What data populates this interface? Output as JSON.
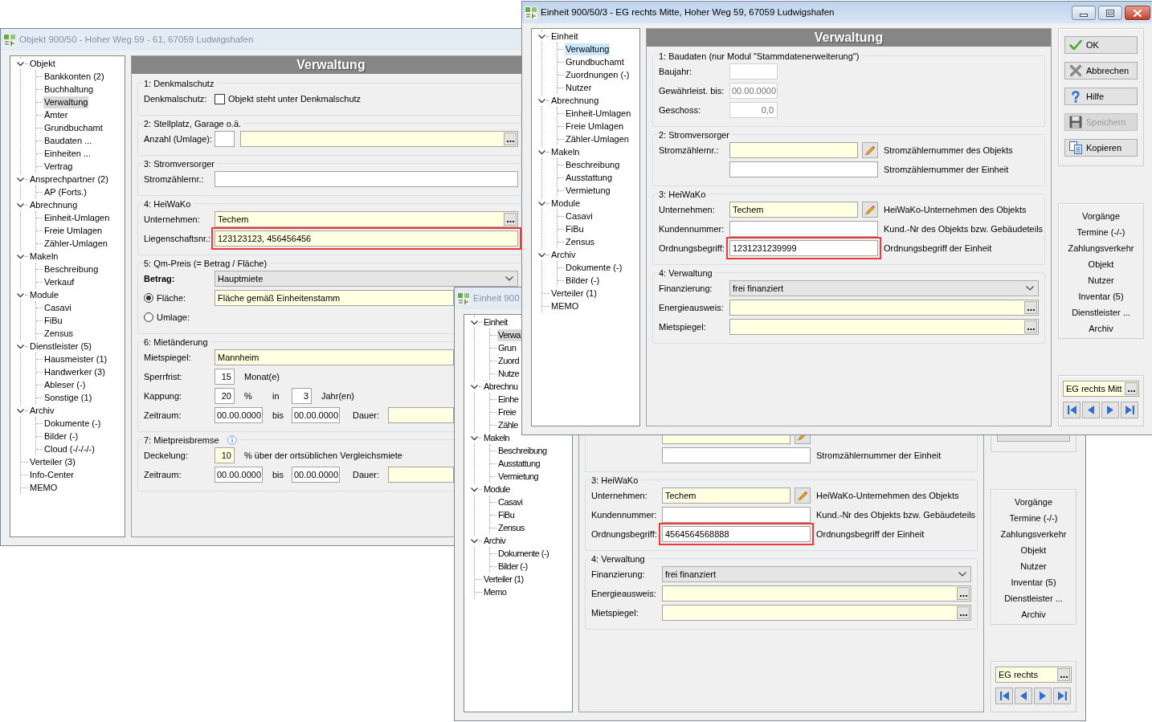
{
  "windows": [
    {
      "title": "Objekt 900/50 - Hoher Weg 59 - 61, 67059 Ludwigshafen",
      "active": false,
      "tree": [
        {
          "label": "Objekt",
          "selected": false,
          "expanded": true,
          "children": [
            {
              "label": "Bankkonten (2)",
              "selected": false
            },
            {
              "label": "Buchhaltung",
              "selected": false
            },
            {
              "label": "Verwaltung",
              "selected": true
            },
            {
              "label": "Ämter",
              "selected": false
            },
            {
              "label": "Grundbuchamt",
              "selected": false
            },
            {
              "label": "Baudaten ...",
              "selected": false
            },
            {
              "label": "Einheiten ...",
              "selected": false
            },
            {
              "label": "Vertrag",
              "selected": false
            }
          ]
        },
        {
          "label": "Ansprechpartner (2)",
          "selected": false,
          "expanded": true,
          "children": [
            {
              "label": "AP (Forts.)",
              "selected": false
            }
          ]
        },
        {
          "label": "Abrechnung",
          "selected": false,
          "expanded": true,
          "children": [
            {
              "label": "Einheit-Umlagen",
              "selected": false
            },
            {
              "label": "Freie Umlagen",
              "selected": false
            },
            {
              "label": "Zähler-Umlagen",
              "selected": false
            }
          ]
        },
        {
          "label": "Makeln",
          "selected": false,
          "expanded": true,
          "children": [
            {
              "label": "Beschreibung",
              "selected": false
            },
            {
              "label": "Verkauf",
              "selected": false
            }
          ]
        },
        {
          "label": "Module",
          "selected": false,
          "expanded": true,
          "children": [
            {
              "label": "Casavi",
              "selected": false
            },
            {
              "label": "FiBu",
              "selected": false
            },
            {
              "label": "Zensus",
              "selected": false
            }
          ]
        },
        {
          "label": "Dienstleister (5)",
          "selected": false,
          "expanded": true,
          "children": [
            {
              "label": "Hausmeister (1)",
              "selected": false
            },
            {
              "label": "Handwerker (3)",
              "selected": false
            },
            {
              "label": "Ableser (-)",
              "selected": false
            },
            {
              "label": "Sonstige (1)",
              "selected": false
            }
          ]
        },
        {
          "label": "Archiv",
          "selected": false,
          "expanded": true,
          "children": [
            {
              "label": "Dokumente (-)",
              "selected": false
            },
            {
              "label": "Bilder (-)",
              "selected": false
            },
            {
              "label": "Cloud (-/-/-/-)",
              "selected": false
            }
          ]
        },
        {
          "label": "Verteiler (3)",
          "selected": false
        },
        {
          "label": "Info-Center",
          "selected": false
        },
        {
          "label": "MEMO",
          "selected": false
        }
      ],
      "form": {
        "title": "Verwaltung",
        "groups": [
          {
            "title": "1: Denkmalschutz",
            "rows": [
              {
                "kind": "plain",
                "label": "Denkmalschutz:",
                "controls": [
                  {
                    "kind": "checkbox",
                    "text": "Objekt steht unter Denkmalschutz",
                    "checked": false
                  }
                ]
              }
            ]
          },
          {
            "title": "2: Stellplatz, Garage o.ä.",
            "rows": [
              {
                "kind": "plain",
                "label": "Anzahl (Umlage):",
                "controls": [
                  {
                    "kind": "number",
                    "readonly": false
                  },
                  {
                    "kind": "lookup",
                    "readonly": true
                  }
                ]
              }
            ]
          },
          {
            "title": "3: Stromversorger",
            "rows": [
              {
                "kind": "plain",
                "label": "Stromzählernr.:",
                "controls": [
                  {
                    "kind": "input",
                    "readonly": false
                  }
                ]
              }
            ]
          },
          {
            "title": "4: HeiWaKo",
            "rows": [
              {
                "kind": "plain",
                "label": "Unternehmen:",
                "controls": [
                  {
                    "kind": "lookup",
                    "readonly": true,
                    "value": "Techem",
                    "highlighted": false
                  }
                ]
              },
              {
                "kind": "plain",
                "label": "Liegenschaftsnr.:",
                "controls": [
                  {
                    "kind": "input",
                    "readonly": true,
                    "value": "123123123, 456456456",
                    "highlighted": true
                  }
                ]
              }
            ]
          },
          {
            "title": "5: Qm-Preis (= Betrag / Fläche)",
            "rows": [
              {
                "kind": "plain",
                "label": "Betrag:",
                "strong": true,
                "controls": [
                  {
                    "kind": "select",
                    "value": "Hauptmiete"
                  }
                ]
              },
              {
                "kind": "radio",
                "label": "Fläche:",
                "selected": true,
                "controls": [
                  {
                    "kind": "input",
                    "readonly": true,
                    "value": "Fläche gemäß Einheitenstamm"
                  }
                ]
              },
              {
                "kind": "radio",
                "label": "Umlage:",
                "selected": false
              }
            ]
          },
          {
            "title": "6: Mietänderung",
            "rows": [
              {
                "kind": "plain",
                "label": "Mietspiegel:",
                "controls": [
                  {
                    "kind": "input",
                    "readonly": true,
                    "value": "Mannheim"
                  }
                ]
              },
              {
                "kind": "plain",
                "label": "Sperrfrist:",
                "controls": [
                  {
                    "kind": "number",
                    "readonly": false,
                    "value": "15"
                  },
                  {
                    "kind": "unit",
                    "text": "Monat(e)"
                  }
                ]
              },
              {
                "kind": "plain",
                "label": "Kappung:",
                "controls": [
                  {
                    "kind": "number",
                    "readonly": false,
                    "value": "20"
                  },
                  {
                    "kind": "unit",
                    "text": "%"
                  },
                  {
                    "kind": "conjunction",
                    "text": "in"
                  },
                  {
                    "kind": "number",
                    "readonly": false,
                    "value": "3"
                  },
                  {
                    "kind": "unit",
                    "text": "Jahr(en)"
                  }
                ]
              },
              {
                "kind": "plain",
                "label": "Zeitraum:",
                "controls": [
                  {
                    "kind": "date",
                    "readonly": false,
                    "value": "00.00.0000"
                  },
                  {
                    "kind": "conjunction",
                    "text": "bis"
                  },
                  {
                    "kind": "date",
                    "readonly": false,
                    "value": "00.00.0000"
                  },
                  {
                    "kind": "inline_label",
                    "text": "Dauer:"
                  },
                  {
                    "kind": "input",
                    "readonly": true
                  }
                ]
              }
            ]
          },
          {
            "title": "7: Mietpreisbremse",
            "info": true,
            "rows": [
              {
                "kind": "plain",
                "label": "Deckelung:",
                "controls": [
                  {
                    "kind": "number",
                    "readonly": true,
                    "value": "10"
                  },
                  {
                    "kind": "unit",
                    "text": "% über der ortsüblichen Vergleichsmiete"
                  }
                ]
              },
              {
                "kind": "plain",
                "label": "Zeitraum:",
                "controls": [
                  {
                    "kind": "date",
                    "readonly": false,
                    "value": "00.00.0000"
                  },
                  {
                    "kind": "conjunction",
                    "text": "bis"
                  },
                  {
                    "kind": "date",
                    "readonly": false,
                    "value": "00.00.0000"
                  },
                  {
                    "kind": "inline_label",
                    "text": "Dauer:"
                  },
                  {
                    "kind": "input",
                    "readonly": true
                  }
                ]
              }
            ]
          }
        ]
      }
    },
    {
      "title": "Einheit 900",
      "active": false,
      "tree": [
        {
          "label": "Einheit",
          "selected": false,
          "expanded": true,
          "children": [
            {
              "label": "Verwa",
              "selected": true
            },
            {
              "label": "Grun",
              "selected": false
            },
            {
              "label": "Zuord",
              "selected": false
            },
            {
              "label": "Nutze",
              "selected": false
            }
          ]
        },
        {
          "label": "Abrechnu",
          "selected": false,
          "expanded": true,
          "children": [
            {
              "label": "Einhe",
              "selected": false
            },
            {
              "label": "Freie",
              "selected": false
            },
            {
              "label": "Zähle",
              "selected": false
            }
          ]
        },
        {
          "label": "Makeln",
          "selected": false,
          "expanded": true,
          "children": [
            {
              "label": "Beschreibung",
              "selected": false
            },
            {
              "label": "Ausstattung",
              "selected": false
            },
            {
              "label": "Vermietung",
              "selected": false
            }
          ]
        },
        {
          "label": "Module",
          "selected": false,
          "expanded": true,
          "children": [
            {
              "label": "Casavi",
              "selected": false
            },
            {
              "label": "FiBu",
              "selected": false
            },
            {
              "label": "Zensus",
              "selected": false
            }
          ]
        },
        {
          "label": "Archiv",
          "selected": false,
          "expanded": true,
          "children": [
            {
              "label": "Dokumente (-)",
              "selected": false
            },
            {
              "label": "Bilder (-)",
              "selected": false
            }
          ]
        },
        {
          "label": "Verteiler (1)",
          "selected": false
        },
        {
          "label": "Memo",
          "selected": false
        }
      ],
      "form": {
        "groups": [
          {
            "rows": [
              {
                "kind": "described",
                "controls": [
                  {
                    "kind": "input",
                    "readonly": true
                  },
                  {
                    "kind": "pencil"
                  }
                ]
              },
              {
                "kind": "described",
                "controls": [
                  {
                    "kind": "input",
                    "readonly": false
                  },
                  {
                    "kind": "hint",
                    "text": "Stromzählernummer der Einheit"
                  }
                ]
              }
            ]
          },
          {
            "title": "3: HeiWaKo",
            "rows": [
              {
                "kind": "described",
                "label": "Unternehmen:",
                "controls": [
                  {
                    "kind": "input",
                    "readonly": true,
                    "value": "Techem",
                    "highlighted": false
                  },
                  {
                    "kind": "pencil"
                  },
                  {
                    "kind": "hint",
                    "text": "HeiWaKo-Unternehmen des Objekts"
                  }
                ]
              },
              {
                "kind": "described",
                "label": "Kundennummer:",
                "controls": [
                  {
                    "kind": "input",
                    "readonly": false,
                    "highlighted": false
                  },
                  {
                    "kind": "hint",
                    "text": "Kund.-Nr des Objekts bzw. Gebäudeteils"
                  }
                ]
              },
              {
                "kind": "described",
                "label": "Ordnungsbegriff:",
                "controls": [
                  {
                    "kind": "input",
                    "readonly": false,
                    "value": "4564564568888",
                    "highlighted": true
                  },
                  {
                    "kind": "hint",
                    "text": "Ordnungsbegriff der Einheit"
                  }
                ]
              }
            ]
          },
          {
            "title": "4: Verwaltung",
            "rows": [
              {
                "kind": "plain",
                "label": "Finanzierung:",
                "controls": [
                  {
                    "kind": "select",
                    "value": "frei finanziert"
                  }
                ]
              },
              {
                "kind": "plain",
                "label": "Energieausweis:",
                "controls": [
                  {
                    "kind": "lookup",
                    "readonly": true
                  }
                ]
              },
              {
                "kind": "plain",
                "label": "Mietspiegel:",
                "controls": [
                  {
                    "kind": "lookup",
                    "readonly": true
                  }
                ]
              }
            ]
          }
        ]
      },
      "actions": [
        {
          "kind": "blank",
          "disabled": false
        }
      ],
      "links": [
        "Vorgänge",
        "Termine (-/-)",
        "Zahlungsverkehr",
        "Objekt",
        "Nutzer",
        "Inventar (5)",
        "Dienstleister ...",
        "Archiv"
      ],
      "record": {
        "value": "EG rechts"
      }
    },
    {
      "title": "Einheit 900/50/3 - EG rechts Mitte, Hoher Weg 59, 67059 Ludwigshafen",
      "active": true,
      "caption_buttons": [
        {
          "kind": "minimize"
        },
        {
          "kind": "maximize"
        },
        {
          "kind": "close"
        }
      ],
      "tree": [
        {
          "label": "Einheit",
          "selected": false,
          "expanded": true,
          "children": [
            {
              "label": "Verwaltung",
              "selected": true
            },
            {
              "label": "Grundbuchamt",
              "selected": false
            },
            {
              "label": "Zuordnungen (-)",
              "selected": false
            },
            {
              "label": "Nutzer",
              "selected": false
            }
          ]
        },
        {
          "label": "Abrechnung",
          "selected": false,
          "expanded": true,
          "children": [
            {
              "label": "Einheit-Umlagen",
              "selected": false
            },
            {
              "label": "Freie Umlagen",
              "selected": false
            },
            {
              "label": "Zähler-Umlagen",
              "selected": false
            }
          ]
        },
        {
          "label": "Makeln",
          "selected": false,
          "expanded": true,
          "children": [
            {
              "label": "Beschreibung",
              "selected": false
            },
            {
              "label": "Ausstattung",
              "selected": false
            },
            {
              "label": "Vermietung",
              "selected": false
            }
          ]
        },
        {
          "label": "Module",
          "selected": false,
          "expanded": true,
          "children": [
            {
              "label": "Casavi",
              "selected": false
            },
            {
              "label": "FiBu",
              "selected": false
            },
            {
              "label": "Zensus",
              "selected": false
            }
          ]
        },
        {
          "label": "Archiv",
          "selected": false,
          "expanded": true,
          "children": [
            {
              "label": "Dokumente (-)",
              "selected": false
            },
            {
              "label": "Bilder (-)",
              "selected": false
            }
          ]
        },
        {
          "label": "Verteiler (1)",
          "selected": false
        },
        {
          "label": "MEMO",
          "selected": false
        }
      ],
      "form": {
        "title": "Verwaltung",
        "groups": [
          {
            "title": "1: Baudaten (nur Modul \"Stammdatenerweiterung\")",
            "rows": [
              {
                "kind": "plain",
                "label": "Baujahr:",
                "controls": [
                  {
                    "kind": "date",
                    "disabled": true
                  }
                ]
              },
              {
                "kind": "plain",
                "label": "Gewährleist. bis:",
                "controls": [
                  {
                    "kind": "date",
                    "disabled": true,
                    "value": "00.00.0000"
                  }
                ]
              },
              {
                "kind": "plain",
                "label": "Geschoss:",
                "controls": [
                  {
                    "kind": "decimal",
                    "disabled": true,
                    "value": "0,0"
                  }
                ]
              }
            ]
          },
          {
            "title": "2: Stromversorger",
            "rows": [
              {
                "kind": "described",
                "label": "Stromzählernr.:",
                "controls": [
                  {
                    "kind": "input",
                    "readonly": true
                  },
                  {
                    "kind": "pencil"
                  },
                  {
                    "kind": "hint",
                    "text": "Stromzählernummer des Objekts"
                  }
                ]
              },
              {
                "kind": "described",
                "controls": [
                  {
                    "kind": "input",
                    "readonly": false
                  },
                  {
                    "kind": "hint",
                    "text": "Stromzählernummer der Einheit"
                  }
                ]
              }
            ]
          },
          {
            "title": "3: HeiWaKo",
            "rows": [
              {
                "kind": "described",
                "label": "Unternehmen:",
                "controls": [
                  {
                    "kind": "input",
                    "readonly": true,
                    "value": "Techem",
                    "highlighted": false
                  },
                  {
                    "kind": "pencil"
                  },
                  {
                    "kind": "hint",
                    "text": "HeiWaKo-Unternehmen des Objekts"
                  }
                ]
              },
              {
                "kind": "described",
                "label": "Kundennummer:",
                "controls": [
                  {
                    "kind": "input",
                    "readonly": false,
                    "highlighted": false
                  },
                  {
                    "kind": "hint",
                    "text": "Kund.-Nr des Objekts bzw. Gebäudeteils"
                  }
                ]
              },
              {
                "kind": "described",
                "label": "Ordnungsbegriff:",
                "controls": [
                  {
                    "kind": "input",
                    "readonly": false,
                    "value": "1231231239999",
                    "highlighted": true
                  },
                  {
                    "kind": "hint",
                    "text": "Ordnungsbegriff der Einheit"
                  }
                ]
              }
            ]
          },
          {
            "title": "4: Verwaltung",
            "rows": [
              {
                "kind": "plain",
                "label": "Finanzierung:",
                "controls": [
                  {
                    "kind": "select",
                    "value": "frei finanziert"
                  }
                ]
              },
              {
                "kind": "plain",
                "label": "Energieausweis:",
                "controls": [
                  {
                    "kind": "lookup",
                    "readonly": true
                  }
                ]
              },
              {
                "kind": "plain",
                "label": "Mietspiegel:",
                "controls": [
                  {
                    "kind": "lookup",
                    "readonly": true
                  }
                ]
              }
            ]
          }
        ]
      },
      "actions": [
        {
          "kind": "ok",
          "label": "OK",
          "disabled": false
        },
        {
          "kind": "cancel",
          "label": "Abbrechen",
          "disabled": false
        },
        {
          "kind": "help",
          "label": "Hilfe",
          "disabled": false
        },
        {
          "kind": "save",
          "label": "Speichern",
          "disabled": true
        },
        {
          "kind": "copy",
          "label": "Kopieren",
          "disabled": false
        }
      ],
      "links": [
        "Vorgänge",
        "Termine (-/-)",
        "Zahlungsverkehr",
        "Objekt",
        "Nutzer",
        "Inventar (5)",
        "Dienstleister ...",
        "Archiv"
      ],
      "record": {
        "value": "EG rechts Mitt"
      }
    }
  ]
}
